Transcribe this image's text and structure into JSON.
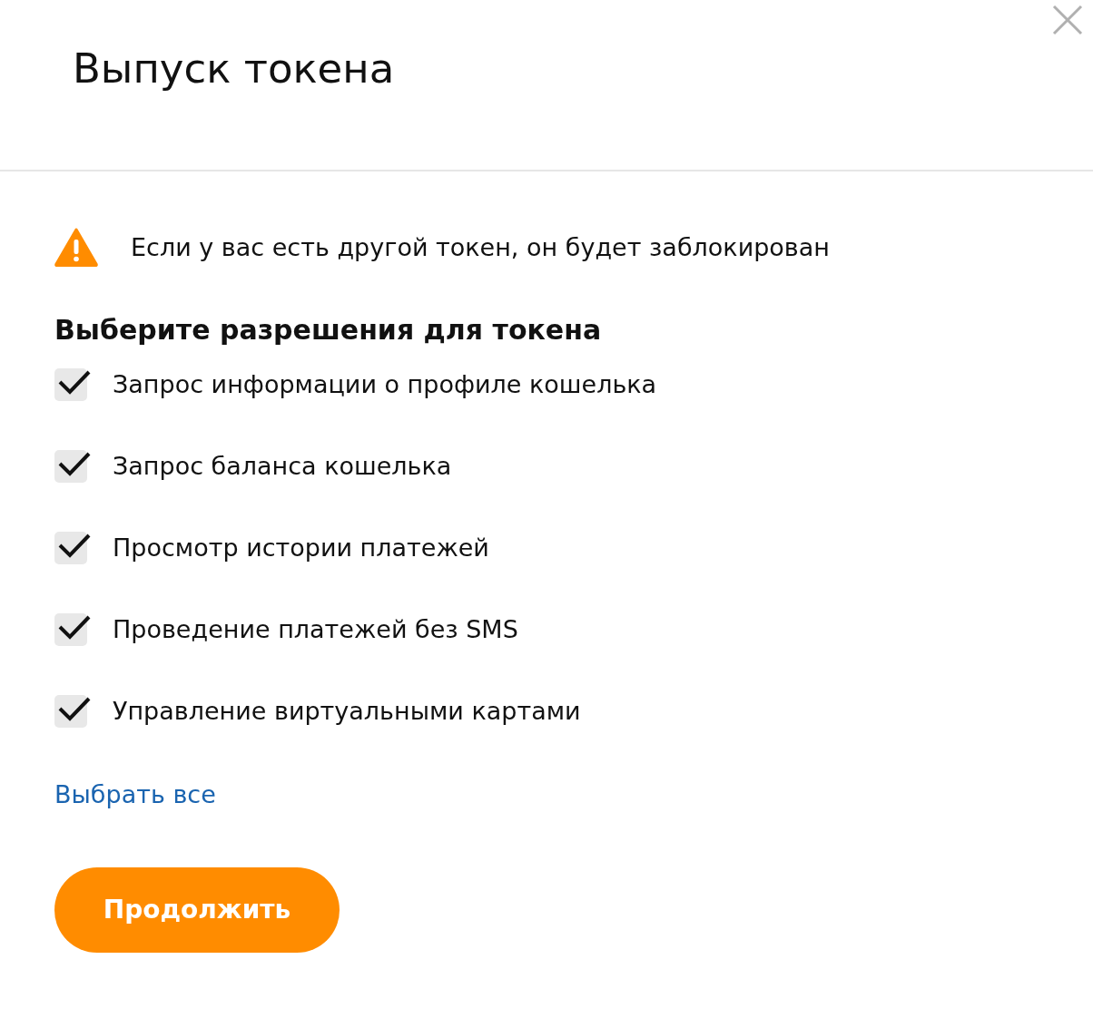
{
  "dialog": {
    "title": "Выпуск токена"
  },
  "warning": "Если у вас есть другой токен, он будет заблокирован",
  "permissions_heading": "Выберите разрешения для токена",
  "permissions": [
    {
      "label": "Запрос информации о профиле кошелька",
      "checked": true
    },
    {
      "label": "Запрос баланса кошелька",
      "checked": true
    },
    {
      "label": "Просмотр истории платежей",
      "checked": true
    },
    {
      "label": "Проведение платежей без SMS",
      "checked": true
    },
    {
      "label": "Управление виртуальными картами",
      "checked": true
    }
  ],
  "select_all_link": "Выбрать все",
  "continue_button": "Продолжить"
}
